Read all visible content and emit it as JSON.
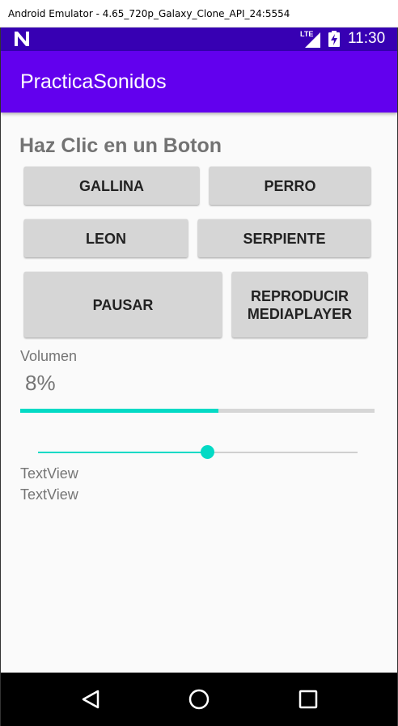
{
  "window": {
    "title": "Android Emulator - 4.65_720p_Galaxy_Clone_API_24:5554"
  },
  "status_bar": {
    "time": "11:30",
    "network": "LTE",
    "icons": [
      "android-n-icon",
      "lte-signal-icon",
      "battery-charging-icon"
    ]
  },
  "app_bar": {
    "title": "PracticaSonidos"
  },
  "main": {
    "heading": "Haz Clic en un Boton",
    "buttons": {
      "gallina": "GALLINA",
      "perro": "PERRO",
      "leon": "LEON",
      "serpiente": "SERPIENTE",
      "pausar": "PAUSAR",
      "reproducir_line1": "REPRODUCIR",
      "reproducir_line2": "MEDIAPLAYER"
    },
    "volume_label": "Volumen",
    "volume_value": "8%",
    "progress_fraction": 0.56,
    "seekbar_fraction": 0.53,
    "text_view_1": "TextView",
    "text_view_2": "TextView"
  },
  "colors": {
    "status_bar": "#3700b3",
    "app_bar": "#6200ee",
    "accent": "#03dac5",
    "button": "#d6d6d6"
  },
  "nav_bar": {
    "icons": [
      "back-icon",
      "home-icon",
      "recents-icon"
    ]
  }
}
